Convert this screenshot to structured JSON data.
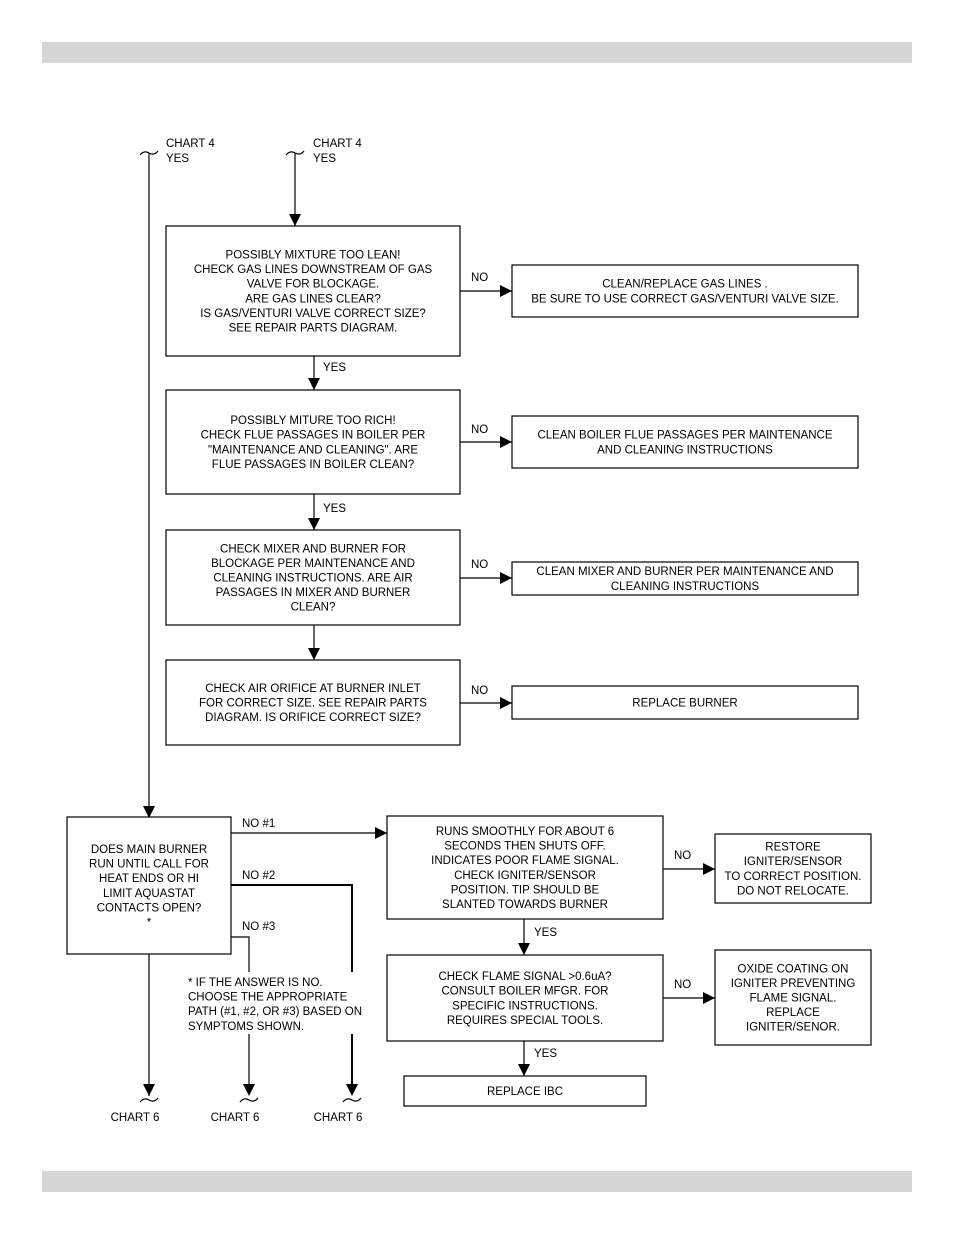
{
  "page": {
    "header_bar_color": "#d6d6d6",
    "footer_bar_color": "#d6d6d6"
  },
  "connectors": {
    "top_left_entry": [
      "CHART 4",
      "YES"
    ],
    "top_center_entry": [
      "CHART 4",
      "YES"
    ],
    "exits": [
      "CHART 6",
      "CHART 6",
      "CHART 6"
    ]
  },
  "labels": {
    "yes": "YES",
    "no": "NO",
    "no1": "NO #1",
    "no2": "NO #2",
    "no3": "NO #3"
  },
  "boxes": {
    "mixture_lean": [
      "POSSIBLY MIXTURE TOO LEAN!",
      "CHECK GAS LINES DOWNSTREAM OF GAS",
      "VALVE FOR BLOCKAGE.",
      "ARE GAS LINES CLEAR?",
      "IS GAS/VENTURI VALVE CORRECT SIZE?",
      "SEE REPAIR PARTS DIAGRAM."
    ],
    "clean_gas_lines": [
      "CLEAN/REPLACE GAS LINES .",
      "BE SURE TO USE CORRECT GAS/VENTURI VALVE SIZE."
    ],
    "mixture_rich": [
      "POSSIBLY MITURE TOO RICH!",
      "CHECK FLUE PASSAGES IN BOILER PER",
      "\"MAINTENANCE AND CLEANING\". ARE",
      "FLUE PASSAGES IN BOILER CLEAN?"
    ],
    "clean_flue": [
      "CLEAN BOILER FLUE PASSAGES PER MAINTENANCE",
      "AND CLEANING INSTRUCTIONS"
    ],
    "check_mixer": [
      "CHECK MIXER AND BURNER FOR",
      "BLOCKAGE PER MAINTENANCE AND",
      "CLEANING INSTRUCTIONS. ARE AIR",
      "PASSAGES IN MIXER AND BURNER",
      "CLEAN?"
    ],
    "clean_mixer": [
      "CLEAN MIXER AND BURNER PER MAINTENANCE AND",
      "CLEANING INSTRUCTIONS"
    ],
    "check_orifice": [
      "CHECK AIR ORIFICE AT BURNER INLET",
      "FOR CORRECT SIZE. SEE REPAIR PARTS",
      "DIAGRAM. IS ORIFICE CORRECT SIZE?"
    ],
    "replace_burner": [
      "REPLACE BURNER"
    ],
    "main_burner": [
      "DOES MAIN BURNER",
      "RUN UNTIL CALL FOR",
      "HEAT ENDS OR HI",
      "LIMIT AQUASTAT",
      "CONTACTS OPEN?",
      "*"
    ],
    "runs_smoothly": [
      "RUNS SMOOTHLY FOR ABOUT 6",
      "SECONDS THEN SHUTS OFF.",
      "INDICATES POOR FLAME SIGNAL.",
      "CHECK IGNITER/SENSOR",
      "POSITION. TIP SHOULD BE",
      "SLANTED TOWARDS BURNER"
    ],
    "restore_igniter": [
      "RESTORE",
      "IGNITER/SENSOR",
      "TO CORRECT POSITION.",
      "DO NOT RELOCATE."
    ],
    "flame_signal": [
      "CHECK FLAME SIGNAL >0.6uA?",
      "CONSULT BOILER MFGR. FOR",
      "SPECIFIC INSTRUCTIONS.",
      "REQUIRES SPECIAL TOOLS."
    ],
    "oxide_coating": [
      "OXIDE COATING ON",
      "IGNITER PREVENTING",
      "FLAME SIGNAL.",
      "REPLACE",
      "IGNITER/SENOR."
    ],
    "replace_ibc": [
      "REPLACE IBC"
    ]
  },
  "footnote": [
    "* IF THE ANSWER IS NO.",
    "CHOOSE THE APPROPRIATE",
    "PATH (#1, #2, OR #3) BASED ON",
    "SYMPTOMS SHOWN."
  ]
}
